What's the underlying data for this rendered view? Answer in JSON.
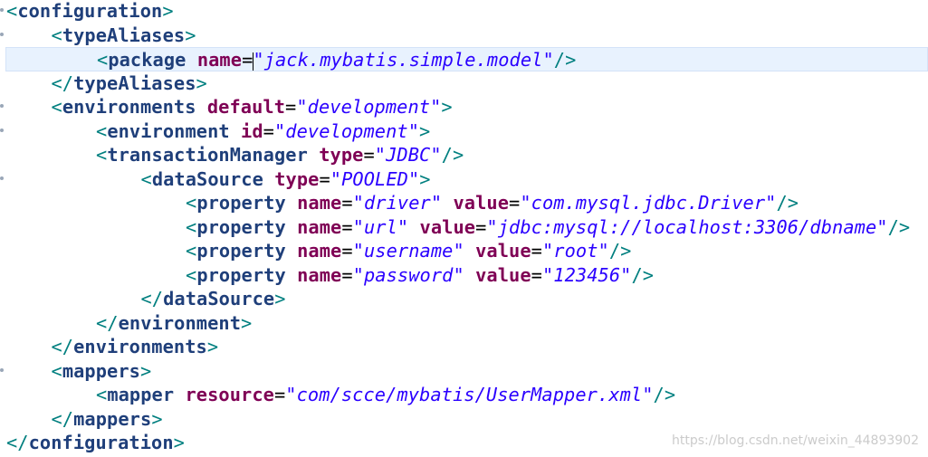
{
  "editor": {
    "lines": [
      {
        "indent": 0,
        "parts": [
          [
            "b",
            "<"
          ],
          [
            "t",
            "configuration"
          ],
          [
            "b",
            ">"
          ]
        ]
      },
      {
        "indent": 1,
        "parts": [
          [
            "b",
            "<"
          ],
          [
            "t",
            "typeAliases"
          ],
          [
            "b",
            ">"
          ]
        ]
      },
      {
        "indent": 2,
        "current": true,
        "parts": [
          [
            "b",
            "<"
          ],
          [
            "t",
            "package"
          ],
          [
            "sp",
            " "
          ],
          [
            "a",
            "name"
          ],
          [
            "eq",
            "="
          ],
          [
            "caret",
            ""
          ],
          [
            "v",
            "\"jack.mybatis.simple.model\""
          ],
          [
            "b",
            "/>"
          ]
        ]
      },
      {
        "indent": 1,
        "parts": [
          [
            "b",
            "</"
          ],
          [
            "t",
            "typeAliases"
          ],
          [
            "b",
            ">"
          ]
        ]
      },
      {
        "indent": 1,
        "parts": [
          [
            "b",
            "<"
          ],
          [
            "t",
            "environments"
          ],
          [
            "sp",
            " "
          ],
          [
            "a",
            "default"
          ],
          [
            "eq",
            "="
          ],
          [
            "v",
            "\"development\""
          ],
          [
            "b",
            ">"
          ]
        ]
      },
      {
        "indent": 2,
        "parts": [
          [
            "b",
            "<"
          ],
          [
            "t",
            "environment"
          ],
          [
            "sp",
            " "
          ],
          [
            "a",
            "id"
          ],
          [
            "eq",
            "="
          ],
          [
            "v",
            "\"development\""
          ],
          [
            "b",
            ">"
          ]
        ]
      },
      {
        "indent": 2,
        "parts": [
          [
            "b",
            "<"
          ],
          [
            "t",
            "transactionManager"
          ],
          [
            "sp",
            " "
          ],
          [
            "a",
            "type"
          ],
          [
            "eq",
            "="
          ],
          [
            "v",
            "\"JDBC\""
          ],
          [
            "b",
            "/>"
          ]
        ]
      },
      {
        "indent": 3,
        "parts": [
          [
            "b",
            "<"
          ],
          [
            "t",
            "dataSource"
          ],
          [
            "sp",
            " "
          ],
          [
            "a",
            "type"
          ],
          [
            "eq",
            "="
          ],
          [
            "v",
            "\"POOLED\""
          ],
          [
            "b",
            ">"
          ]
        ]
      },
      {
        "indent": 4,
        "parts": [
          [
            "b",
            "<"
          ],
          [
            "t",
            "property"
          ],
          [
            "sp",
            " "
          ],
          [
            "a",
            "name"
          ],
          [
            "eq",
            "="
          ],
          [
            "v",
            "\"driver\""
          ],
          [
            "sp",
            " "
          ],
          [
            "a",
            "value"
          ],
          [
            "eq",
            "="
          ],
          [
            "v",
            "\"com.mysql.jdbc.Driver\""
          ],
          [
            "b",
            "/>"
          ]
        ]
      },
      {
        "indent": 4,
        "parts": [
          [
            "b",
            "<"
          ],
          [
            "t",
            "property"
          ],
          [
            "sp",
            " "
          ],
          [
            "a",
            "name"
          ],
          [
            "eq",
            "="
          ],
          [
            "v",
            "\"url\""
          ],
          [
            "sp",
            " "
          ],
          [
            "a",
            "value"
          ],
          [
            "eq",
            "="
          ],
          [
            "v",
            "\"jdbc:mysql://localhost:3306/dbname\""
          ],
          [
            "b",
            "/>"
          ]
        ]
      },
      {
        "indent": 4,
        "parts": [
          [
            "b",
            "<"
          ],
          [
            "t",
            "property"
          ],
          [
            "sp",
            " "
          ],
          [
            "a",
            "name"
          ],
          [
            "eq",
            "="
          ],
          [
            "v",
            "\"username\""
          ],
          [
            "sp",
            " "
          ],
          [
            "a",
            "value"
          ],
          [
            "eq",
            "="
          ],
          [
            "v",
            "\"root\""
          ],
          [
            "b",
            "/>"
          ]
        ]
      },
      {
        "indent": 4,
        "parts": [
          [
            "b",
            "<"
          ],
          [
            "t",
            "property"
          ],
          [
            "sp",
            " "
          ],
          [
            "a",
            "name"
          ],
          [
            "eq",
            "="
          ],
          [
            "v",
            "\"password\""
          ],
          [
            "sp",
            " "
          ],
          [
            "a",
            "value"
          ],
          [
            "eq",
            "="
          ],
          [
            "v",
            "\"123456\""
          ],
          [
            "b",
            "/>"
          ]
        ]
      },
      {
        "indent": 3,
        "parts": [
          [
            "b",
            "</"
          ],
          [
            "t",
            "dataSource"
          ],
          [
            "b",
            ">"
          ]
        ]
      },
      {
        "indent": 2,
        "parts": [
          [
            "b",
            "</"
          ],
          [
            "t",
            "environment"
          ],
          [
            "b",
            ">"
          ]
        ]
      },
      {
        "indent": 1,
        "parts": [
          [
            "b",
            "</"
          ],
          [
            "t",
            "environments"
          ],
          [
            "b",
            ">"
          ]
        ]
      },
      {
        "indent": 1,
        "parts": [
          [
            "b",
            "<"
          ],
          [
            "t",
            "mappers"
          ],
          [
            "b",
            ">"
          ]
        ]
      },
      {
        "indent": 2,
        "parts": [
          [
            "b",
            "<"
          ],
          [
            "t",
            "mapper"
          ],
          [
            "sp",
            " "
          ],
          [
            "a",
            "resource"
          ],
          [
            "eq",
            "="
          ],
          [
            "v",
            "\"com/scce/mybatis/UserMapper.xml\""
          ],
          [
            "b",
            "/>"
          ]
        ]
      },
      {
        "indent": 1,
        "parts": [
          [
            "b",
            "</"
          ],
          [
            "t",
            "mappers"
          ],
          [
            "b",
            ">"
          ]
        ]
      },
      {
        "indent": 0,
        "parts": [
          [
            "b",
            "</"
          ],
          [
            "t",
            "configuration"
          ],
          [
            "b",
            ">"
          ]
        ]
      }
    ]
  },
  "watermark": "https://blog.csdn.net/weixin_44893902",
  "colors": {
    "bracket": "#007f7f",
    "tag": "#3f3f7f",
    "attribute": "#7f0055",
    "value": "#2a00ff",
    "current_line": "#e8f2fe"
  }
}
